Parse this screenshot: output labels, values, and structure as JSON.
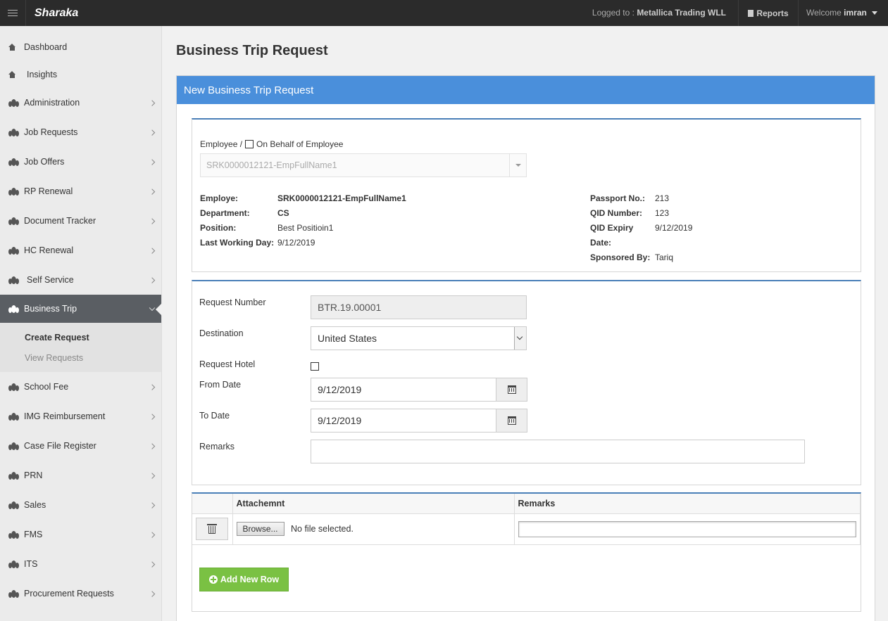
{
  "app": {
    "brand": "Sharaka",
    "logged_prefix": "Logged to :",
    "company": "Metallica Trading WLL",
    "reports": "Reports",
    "welcome_prefix": "Welcome",
    "username": "imran"
  },
  "sidebar": {
    "items": [
      {
        "label": "Dashboard"
      },
      {
        "label": "Insights"
      },
      {
        "label": "Administration"
      },
      {
        "label": "Job Requests"
      },
      {
        "label": "Job Offers"
      },
      {
        "label": "RP Renewal"
      },
      {
        "label": "Document Tracker"
      },
      {
        "label": "HC Renewal"
      },
      {
        "label": "Self Service"
      },
      {
        "label": "Business Trip"
      },
      {
        "label": "School Fee"
      },
      {
        "label": "IMG Reimbursement"
      },
      {
        "label": "Case File Register"
      },
      {
        "label": "PRN"
      },
      {
        "label": "Sales"
      },
      {
        "label": "FMS"
      },
      {
        "label": "ITS"
      },
      {
        "label": "Procurement Requests"
      }
    ],
    "submenu": [
      {
        "label": "Create Request"
      },
      {
        "label": "View Requests"
      }
    ]
  },
  "page": {
    "title": "Business Trip Request",
    "panel_title": "New Business Trip Request"
  },
  "employee": {
    "label": "Employee /",
    "behalf_label": "On Behalf of Employee",
    "select_value": "SRK0000012121-EmpFullName1",
    "left": [
      {
        "k": "Employe:",
        "v": "SRK0000012121-EmpFullName1"
      },
      {
        "k": "Department:",
        "v": "CS"
      },
      {
        "k": "Position:",
        "v": "Best Positioin1"
      },
      {
        "k": "Last Working Day:",
        "v": "9/12/2019"
      }
    ],
    "right": [
      {
        "k": "Passport No.:",
        "v": "213"
      },
      {
        "k": "QID Number:",
        "v": "123"
      },
      {
        "k": "QID Expiry Date:",
        "v": "9/12/2019"
      },
      {
        "k": "Sponsored By:",
        "v": "Tariq"
      }
    ]
  },
  "form": {
    "request_number_label": "Request Number",
    "request_number": "BTR.19.00001",
    "destination_label": "Destination",
    "destination": "United States",
    "hotel_label": "Request Hotel",
    "from_label": "From Date",
    "from_date": "9/12/2019",
    "to_label": "To Date",
    "to_date": "9/12/2019",
    "remarks_label": "Remarks",
    "remarks": ""
  },
  "attachments": {
    "col_attachment": "Attachemnt",
    "col_remarks": "Remarks",
    "browse": "Browse...",
    "no_file": "No file selected.",
    "add_row": "Add New Row"
  }
}
